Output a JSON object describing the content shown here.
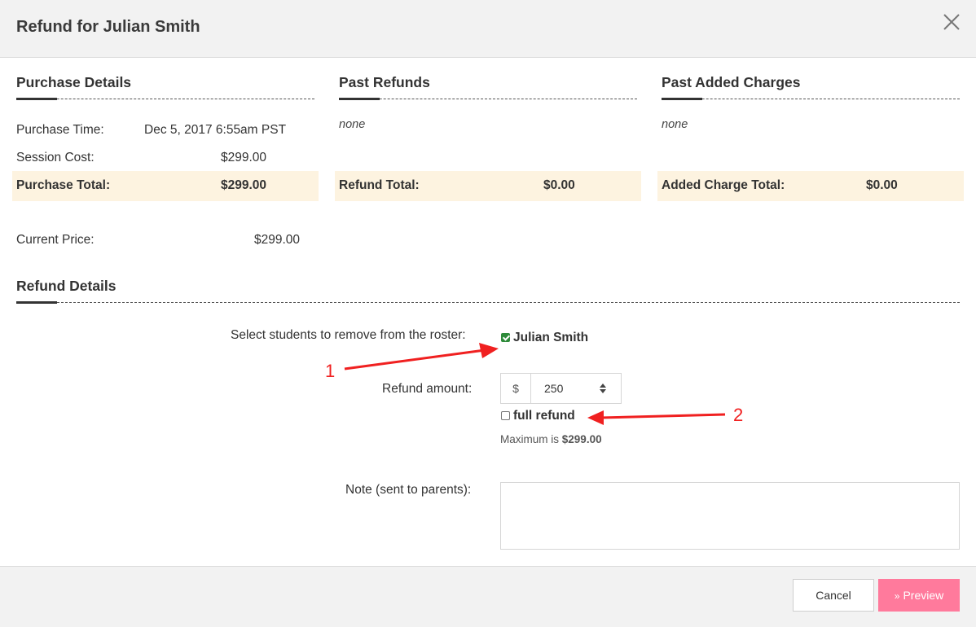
{
  "modal": {
    "title": "Refund for Julian Smith"
  },
  "purchase_details": {
    "heading": "Purchase Details",
    "rows": [
      {
        "label": "Purchase Time:",
        "value": "Dec 5, 2017 6:55am PST"
      },
      {
        "label": "Session Cost:",
        "value": "$299.00"
      }
    ],
    "total_label": "Purchase Total:",
    "total_value": "$299.00"
  },
  "past_refunds": {
    "heading": "Past Refunds",
    "empty_text": "none",
    "total_label": "Refund Total:",
    "total_value": "$0.00"
  },
  "past_added_charges": {
    "heading": "Past Added Charges",
    "empty_text": "none",
    "total_label": "Added Charge Total:",
    "total_value": "$0.00"
  },
  "current_price": {
    "label": "Current Price:",
    "value": "$299.00"
  },
  "refund_details": {
    "heading": "Refund Details",
    "students_label": "Select students to remove from the roster:",
    "students": [
      {
        "name": "Julian Smith",
        "checked": true
      }
    ],
    "amount_label": "Refund amount:",
    "currency_prefix": "$",
    "amount_value": "250",
    "full_refund_label": "full refund",
    "full_refund_checked": false,
    "maximum_prefix": "Maximum is",
    "maximum_value": "$299.00",
    "note_label": "Note (sent to parents):",
    "note_value": ""
  },
  "annotations": {
    "arrow1_label": "1",
    "arrow2_label": "2",
    "color": "#f02020"
  },
  "footer": {
    "cancel_label": "Cancel",
    "preview_label": "Preview"
  },
  "colors": {
    "header_bg": "#f2f2f2",
    "highlight_bg": "#fdf3e0",
    "preview_bg": "#ff7a9c",
    "checkbox_checked": "#2e8b3a"
  }
}
